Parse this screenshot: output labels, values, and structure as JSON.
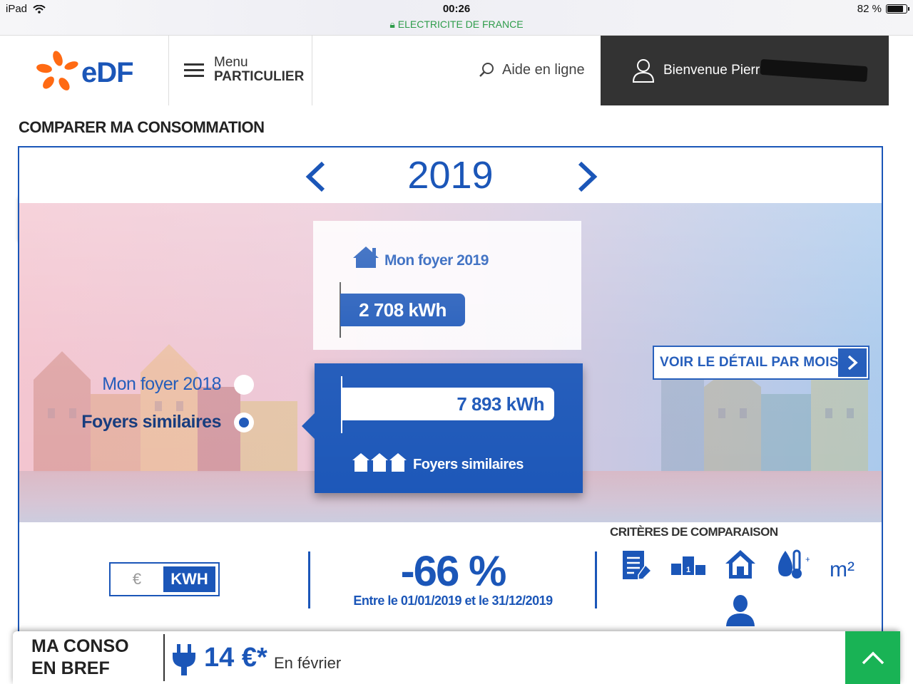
{
  "status_bar": {
    "device": "iPad",
    "time": "00:26",
    "site": "ELECTRICITE DE FRANCE",
    "battery": "82 %"
  },
  "header": {
    "logo_text": "eDF",
    "menu_line1": "Menu",
    "menu_line2": "PARTICULIER",
    "help_label": "Aide en ligne",
    "welcome_text": "Bienvenue Pierre C. "
  },
  "page": {
    "title": "COMPARER MA CONSOMMATION"
  },
  "comparison": {
    "year": "2019",
    "my_home_title": "Mon foyer 2019",
    "my_home_value": "2 708 kWh",
    "similar_value": "7 893 kWh",
    "similar_title": "Foyers similaires",
    "options": [
      {
        "label": "Mon foyer 2018",
        "selected": false
      },
      {
        "label": "Foyers similaires",
        "selected": true
      }
    ],
    "detail_button": "VOIR LE DÉTAIL PAR MOIS"
  },
  "summary": {
    "unit_euro": "€",
    "unit_kwh": "KWH",
    "selected_unit": "KWH",
    "percent": "-66 %",
    "period": "Entre le 01/01/2019 et le 31/12/2019",
    "criteria_title": "CRITÈRES DE COMPARAISON",
    "criteria_icons": [
      "contract-icon",
      "podium-icon",
      "house-icon",
      "water-temperature-icon",
      "surface-icon",
      "person-icon"
    ],
    "surface_unit": "m²"
  },
  "bottom_bar": {
    "title_line1": "MA CONSO",
    "title_line2": "EN BREF",
    "amount": "14 €*",
    "period": "En février"
  },
  "colors": {
    "brand_blue": "#1b56b8",
    "green": "#19b355",
    "orange": "#ff6a13",
    "dark": "#333333"
  }
}
